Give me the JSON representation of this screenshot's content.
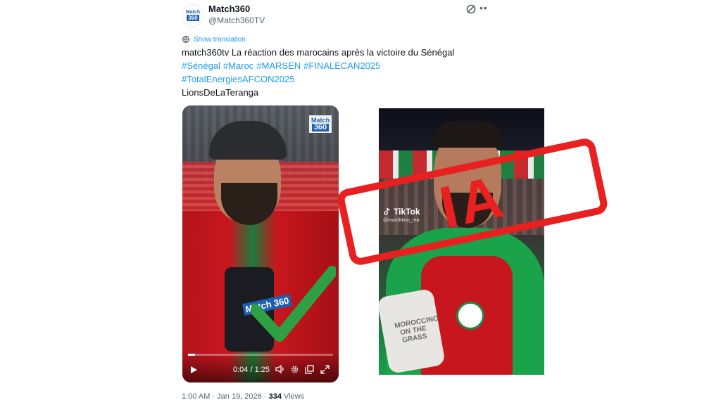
{
  "author": {
    "name": "Match360",
    "handle": "@Match360TV",
    "avatar_line1": "Match",
    "avatar_line2": "360"
  },
  "translate_label": "Show translation",
  "tweet": {
    "text": "match360tv La réaction des marocains après la victoire du Sénégal",
    "hashtags_line1": [
      "#Sénégal",
      "#Maroc",
      "#MARSEN",
      "#FINALECAN2025"
    ],
    "hashtags_line2": [
      "#TotalEnergiesAFCON2025"
    ],
    "last_line": "LionsDeLaTeranga"
  },
  "video": {
    "logo_line1": "Match",
    "logo_line2": "360",
    "mic_label": "Match 360",
    "time": "0:04 / 1:25",
    "progress": 0.05
  },
  "right_image": {
    "watermark": "TikTok",
    "watermark_handle": "@marokkoo_ma",
    "mic_text": "MOROCCINO ON THE GRASS"
  },
  "stamp": {
    "text": "IA",
    "color": "#e8201f"
  },
  "footer": {
    "time": "1:00 AM",
    "separator": "·",
    "date": "Jan 19, 2026",
    "views_count": "334",
    "views_label": "Views"
  },
  "colors": {
    "link": "#1d9bf0",
    "secondary_text": "#536471",
    "check_green": "#2ea043"
  }
}
